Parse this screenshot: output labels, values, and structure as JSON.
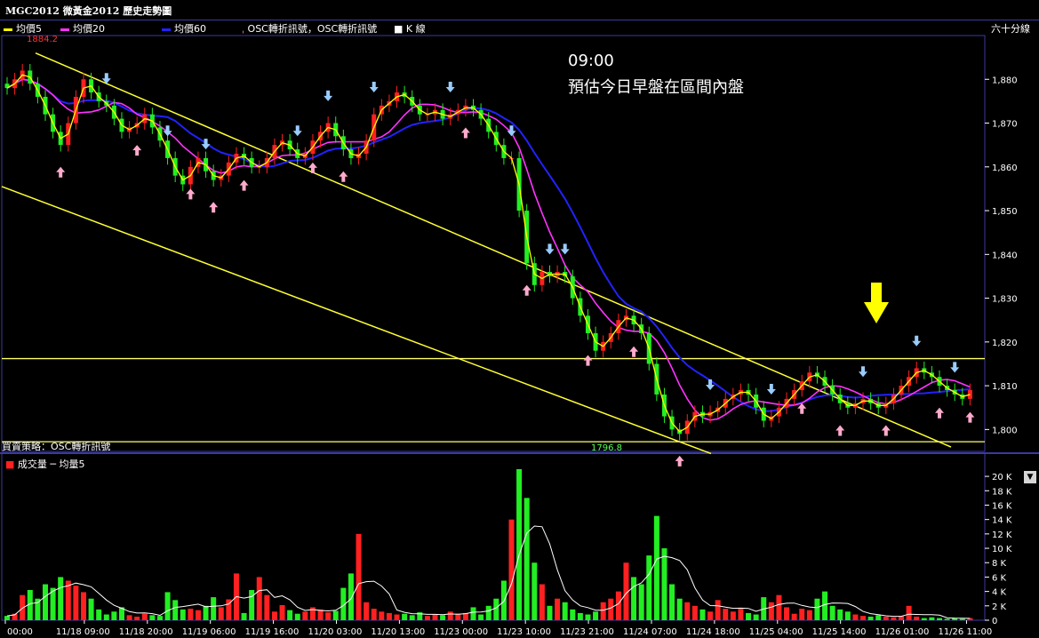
{
  "window": {
    "title": "MGC2012 微黃金2012  歷史走勢圖"
  },
  "legend": {
    "items": [
      {
        "label": "均價5",
        "color": "#ffff00"
      },
      {
        "label": "均價20",
        "color": "#ff33ff"
      },
      {
        "label": "均價60",
        "color": "#2222ff"
      },
      {
        "label": "OSC轉折訊號，OSC轉折訊號",
        "color": "#ff9999"
      },
      {
        "label": "K 線",
        "color": "#ffffff"
      }
    ],
    "period": "六十分線"
  },
  "annotation": {
    "time": "09:00",
    "text": "預估今日早盤在區間內盤"
  },
  "strategy_label": "買賣策略：OSC轉折訊號",
  "volume_legend": "成交量 ─ 均量5",
  "price_markers": {
    "high_label": "1884.2",
    "low_label": "1796.8"
  },
  "colors": {
    "up": "#ff2020",
    "down": "#22ee22",
    "ma5": "#ffff00",
    "ma20": "#ff33ff",
    "ma60": "#2222ff",
    "channel": "#ffff33",
    "hline": "#ffff66"
  },
  "chart_data": {
    "type": "candlestick",
    "y_ticks": [
      "1,880",
      "1,870",
      "1,860",
      "1,850",
      "1,840",
      "1,830",
      "1,820",
      "1,810",
      "1,800"
    ],
    "y_values": [
      1880,
      1870,
      1860,
      1850,
      1840,
      1830,
      1820,
      1810,
      1800
    ],
    "ylim": [
      1795,
      1890
    ],
    "vol_ticks": [
      "20 K",
      "18 K",
      "16 K",
      "14 K",
      "12 K",
      "10 K",
      "8 K",
      "6 K",
      "4 K",
      "2 K",
      "0"
    ],
    "vol_values": [
      20000,
      18000,
      16000,
      14000,
      12000,
      10000,
      8000,
      6000,
      4000,
      2000,
      0
    ],
    "x_labels": [
      "00:00",
      "11/18 09:00",
      "11/18 20:00",
      "11/19 06:00",
      "11/19 16:00",
      "11/20 03:00",
      "11/20 13:00",
      "11/23 00:00",
      "11/23 10:00",
      "11/23 21:00",
      "11/24 07:00",
      "11/24 18:00",
      "11/25 04:00",
      "11/25 14:00",
      "11/26 01:00",
      "11/26 11:00"
    ],
    "close": [
      1878,
      1880,
      1882,
      1879,
      1876,
      1872,
      1868,
      1865,
      1870,
      1876,
      1880,
      1877,
      1875,
      1874,
      1871,
      1868,
      1869,
      1870,
      1872,
      1869,
      1866,
      1862,
      1858,
      1856,
      1860,
      1862,
      1859,
      1857,
      1858,
      1861,
      1863,
      1862,
      1860,
      1860,
      1862,
      1865,
      1866,
      1864,
      1862,
      1863,
      1866,
      1868,
      1870,
      1867,
      1864,
      1862,
      1863,
      1866,
      1872,
      1874,
      1875,
      1877,
      1876,
      1874,
      1872,
      1872,
      1873,
      1871,
      1872,
      1873,
      1874,
      1873,
      1871,
      1868,
      1865,
      1862,
      1862,
      1850,
      1838,
      1833,
      1836,
      1835,
      1836,
      1835,
      1830,
      1826,
      1822,
      1818,
      1820,
      1822,
      1825,
      1826,
      1824,
      1822,
      1815,
      1808,
      1803,
      1800,
      1799,
      1802,
      1804,
      1803,
      1804,
      1805,
      1807,
      1808,
      1809,
      1808,
      1805,
      1802,
      1803,
      1805,
      1807,
      1809,
      1811,
      1813,
      1812,
      1810,
      1808,
      1806,
      1805,
      1806,
      1807,
      1806,
      1805,
      1806,
      1808,
      1810,
      1812,
      1814,
      1813,
      1812,
      1810,
      1809,
      1808,
      1807,
      1809
    ],
    "volume": [
      600,
      900,
      3500,
      4200,
      3000,
      5000,
      4500,
      6000,
      5500,
      4800,
      3900,
      3000,
      1500,
      800,
      1200,
      1800,
      700,
      500,
      900,
      700,
      600,
      3900,
      2800,
      1500,
      1600,
      1400,
      2000,
      3200,
      1800,
      2900,
      6500,
      1000,
      4200,
      6000,
      3500,
      1200,
      2100,
      1400,
      900,
      1200,
      1800,
      1500,
      1100,
      1300,
      4500,
      6500,
      12000,
      2500,
      1600,
      1200,
      1000,
      800,
      900,
      700,
      1100,
      600,
      800,
      700,
      1200,
      900,
      1000,
      1800,
      800,
      2000,
      3000,
      5500,
      14000,
      21000,
      17000,
      8000,
      5000,
      2000,
      3000,
      2500,
      1500,
      1000,
      800,
      1200,
      2500,
      3000,
      4000,
      8000,
      6000,
      5000,
      9000,
      14500,
      10000,
      5000,
      3000,
      2500,
      2000,
      1500,
      1200,
      2800,
      1600,
      1200,
      1600,
      1000,
      800,
      3200,
      2500,
      3500,
      1800,
      900,
      1600,
      1400,
      3000,
      4000,
      2000,
      1500,
      1200,
      800,
      600,
      500,
      700,
      500,
      400,
      600,
      2000,
      500,
      300,
      400,
      300,
      200,
      300,
      200,
      300
    ]
  }
}
